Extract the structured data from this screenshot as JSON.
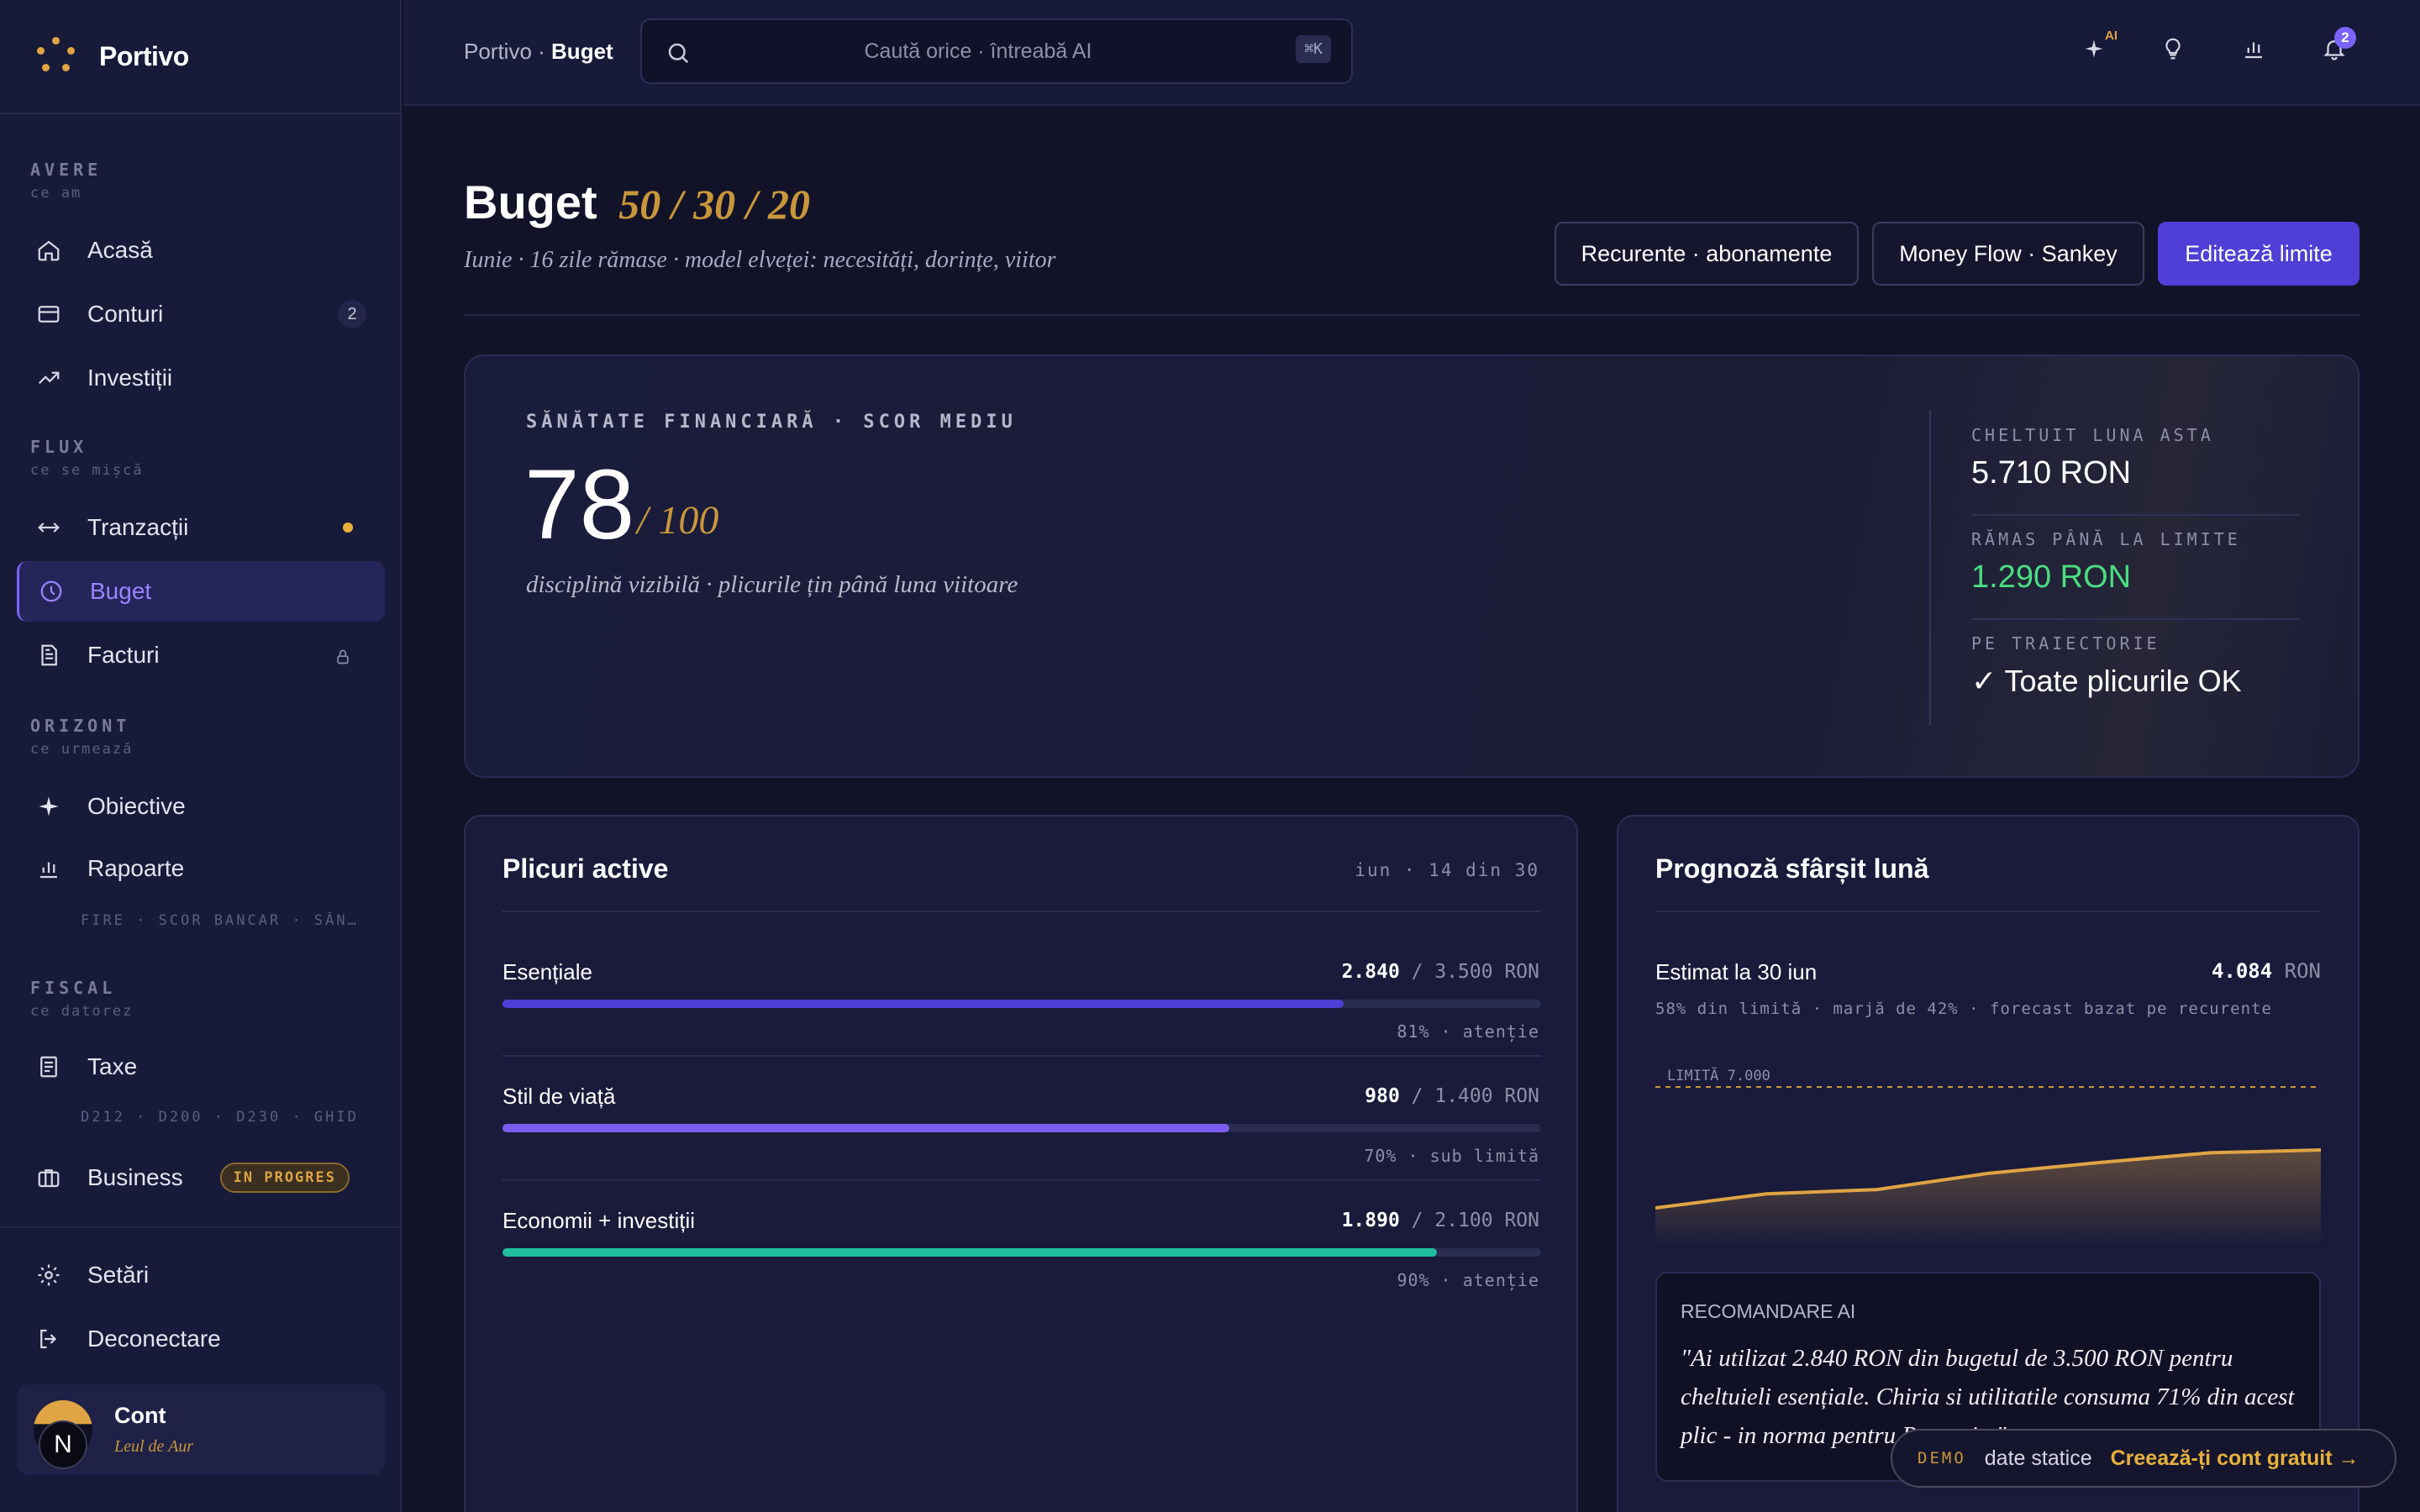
{
  "brand": {
    "name": "Portivo"
  },
  "sidebar": {
    "sections": [
      {
        "title": "AVERE",
        "subtitle": "ce am"
      },
      {
        "title": "FLUX",
        "subtitle": "ce se mișcă"
      },
      {
        "title": "ORIZONT",
        "subtitle": "ce urmează"
      },
      {
        "title": "FISCAL",
        "subtitle": "ce datorez"
      }
    ],
    "items": [
      {
        "label": "Acasă",
        "icon": "home-icon"
      },
      {
        "label": "Conturi",
        "icon": "card-icon",
        "badge": "2"
      },
      {
        "label": "Investiții",
        "icon": "trend-up-icon"
      },
      {
        "label": "Tranzacții",
        "icon": "arrows-horizontal-icon"
      },
      {
        "label": "Buget",
        "icon": "clock-pie-icon",
        "active": true
      },
      {
        "label": "Facturi",
        "icon": "document-icon"
      },
      {
        "label": "Obiective",
        "icon": "sparkle-icon"
      },
      {
        "label": "Rapoarte",
        "icon": "bar-chart-icon",
        "note": "FIRE · SCOR BANCAR · SĂNĂT…"
      },
      {
        "label": "Taxe",
        "icon": "receipt-icon",
        "note": "D212 · D200 · D230 · GHID"
      },
      {
        "label": "Business",
        "icon": "briefcase-icon",
        "pill": "IN PROGRES"
      },
      {
        "label": "Setări",
        "icon": "gear-icon"
      },
      {
        "label": "Deconectare",
        "icon": "logout-icon"
      }
    ],
    "account": {
      "initial": "N",
      "name": "Cont",
      "subtitle": "Leul de Aur"
    }
  },
  "topbar": {
    "breadcrumb_root": "Portivo",
    "breadcrumb_sep": " · ",
    "breadcrumb_current": "Buget",
    "search_placeholder": "Caută orice · întreabă AI",
    "shortcut": "⌘K",
    "ai_label": "AI",
    "notifications": "2"
  },
  "page": {
    "title": "Buget",
    "model": "50 / 30 / 20",
    "subtitle": "Iunie · 16 zile rămase · model elveței: necesități, dorințe, viitor",
    "buttons": [
      "Recurente · abonamente",
      "Money Flow · Sankey",
      "Editează limite"
    ]
  },
  "health": {
    "label": "SĂNĂTATE FINANCIARĂ · SCOR MEDIU",
    "score": "78",
    "score_of": "/ 100",
    "subtitle": "disciplină vizibilă · plicurile țin până luna viitoare",
    "kpis": [
      {
        "label": "CHELTUIT LUNA ASTA",
        "value": "5.710 RON"
      },
      {
        "label": "RĂMAS PÂNĂ LA LIMITE",
        "value": "1.290 RON"
      },
      {
        "label": "PE TRAIECTORIE",
        "value": "✓ Toate plicurile OK"
      }
    ],
    "colors": {
      "positive": "#4ade80",
      "accent": "#c9973a"
    }
  },
  "envelopes": {
    "title": "Plicuri active",
    "meta": "iun · 14 din 30",
    "items": [
      {
        "name": "Esențiale",
        "spent": "2.840",
        "limit": "/ 3.500 RON",
        "ratio": 0.81,
        "status": "81% · atenție",
        "color": "#4f3fd6"
      },
      {
        "name": "Stil de viață",
        "spent": "980",
        "limit": "/ 1.400 RON",
        "ratio": 0.7,
        "status": "70% · sub limită",
        "color": "#7b5cf0"
      },
      {
        "name": "Economii + investiții",
        "spent": "1.890",
        "limit": "/ 2.100 RON",
        "ratio": 0.9,
        "status": "90% · atenție",
        "color": "#1fbfa0"
      }
    ]
  },
  "forecast": {
    "title": "Prognoză sfârșit lună",
    "label": "Estimat la 30 iun",
    "value": "4.084",
    "unit": "RON",
    "subtitle": "58% din limită · marjă de 42% · forecast bazat pe recurente",
    "limit_label": "LIMITĂ 7.000",
    "recommendation_title": "RECOMANDARE AI",
    "recommendation": "\"Ai utilizat 2.840 RON din bugetul de 3.500 RON pentru cheltuieli esențiale. Chiria si utilitatile consuma 71% din acest plic - in norma pentru Romania.\""
  },
  "chart_data": {
    "type": "area",
    "x": [
      1,
      2,
      3,
      4,
      5,
      6,
      7
    ],
    "values": [
      1400,
      2050,
      2250,
      3000,
      3500,
      3950,
      4084
    ],
    "ylim": [
      0,
      7000
    ],
    "limit": 7000,
    "color": "#e0a444"
  },
  "demo": {
    "tag": "DEMO",
    "text": "date statice",
    "cta": "Creează-ți cont gratuit →"
  }
}
